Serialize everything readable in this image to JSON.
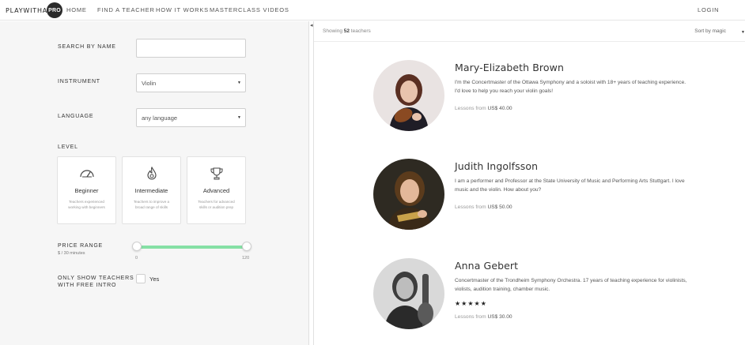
{
  "brand": {
    "name": "PLAYWITHA",
    "badge": "PRO"
  },
  "nav": {
    "items": [
      {
        "label": "HOME"
      },
      {
        "label": "FIND A TEACHER"
      },
      {
        "label": "HOW IT WORKS"
      },
      {
        "label": "MASTERCLASS VIDEOS"
      }
    ],
    "login": "LOGIN"
  },
  "filters": {
    "search_label": "SEARCH BY NAME",
    "search_value": "",
    "instrument_label": "INSTRUMENT",
    "instrument_value": "Violin",
    "language_label": "LANGUAGE",
    "language_value": "any language",
    "level_label": "LEVEL",
    "levels": [
      {
        "title": "Beginner",
        "desc": "Teachers experienced working with beginners",
        "icon": "speedometer-icon"
      },
      {
        "title": "Intermediate",
        "desc": "Teachers to improve a broad range of skills",
        "icon": "flame-icon"
      },
      {
        "title": "Advanced",
        "desc": "Teachers for advanced skills or audition prep",
        "icon": "trophy-icon"
      }
    ],
    "price_label": "PRICE RANGE",
    "price_sub": "$ / 30 minutes",
    "price_min": "0",
    "price_max": "120",
    "intro_label_line1": "ONLY SHOW TEACHERS",
    "intro_label_line2": "WITH FREE INTRO",
    "intro_option": "Yes"
  },
  "results": {
    "showing_prefix": "Showing",
    "count": "52",
    "showing_suffix": "teachers",
    "sort_label": "Sort by magic"
  },
  "teachers": [
    {
      "name": "Mary-Elizabeth Brown",
      "bio": "I'm the Concertmaster of the Ottawa Symphony and a soloist with 18+ years of teaching experience. I'd love to help you reach your violin goals!",
      "price_prefix": "Lessons from",
      "price": "US$ 40.00",
      "stars": ""
    },
    {
      "name": "Judith Ingolfsson",
      "bio": "I am a performer and Professor at the State University of Music and Performing Arts Stuttgart. I love music and the violin. How about you?",
      "price_prefix": "Lessons from",
      "price": "US$ 50.00",
      "stars": ""
    },
    {
      "name": "Anna Gebert",
      "bio": "Concertmaster of the Trondheim Symphony Orchestra. 17 years of teaching experience for violinists, violists, audition training, chamber music.",
      "price_prefix": "Lessons from",
      "price": "US$ 30.00",
      "stars": "★★★★★"
    }
  ],
  "colors": {
    "slider": "#86e0a5",
    "panel": "#f6f6f6"
  }
}
